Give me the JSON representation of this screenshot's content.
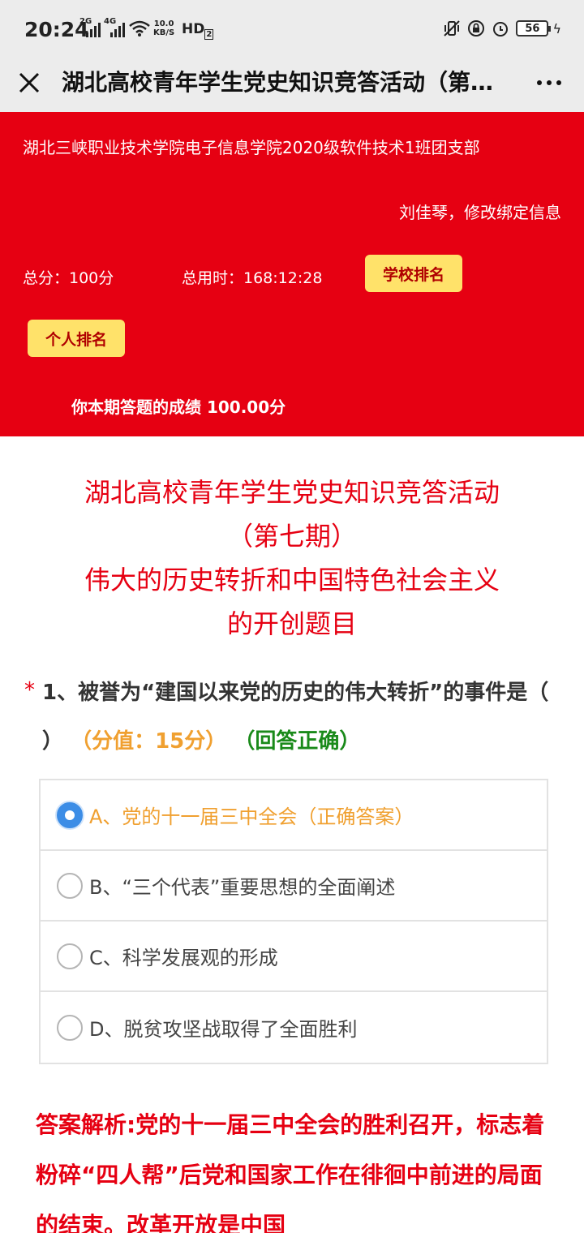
{
  "status_bar": {
    "time": "20:24",
    "signal_1": "2G",
    "signal_2": "4G",
    "network_speed": "10.0",
    "network_unit": "KB/S",
    "hd": "HD",
    "hd_sub": "2",
    "battery": "56",
    "icons": [
      "signal-icon",
      "wifi-icon",
      "vibrate-icon",
      "lock-icon",
      "alarm-icon",
      "battery-icon",
      "charging-icon"
    ]
  },
  "header": {
    "title": "湖北高校青年学生党史知识竞答活动（第…"
  },
  "banner": {
    "org": "湖北三峡职业技术学院电子信息学院2020级软件技术1班团支部",
    "user_line": "刘佳琴，修改绑定信息",
    "total_score": "总分：100分",
    "total_time": "总用时：168:12:28",
    "school_rank_label": "学校排名",
    "personal_rank_label": "个人排名",
    "result": "你本期答题的成绩 100.00分"
  },
  "quiz": {
    "title_line1": "湖北高校青年学生党史知识竞答活动",
    "title_line2": "（第七期）",
    "title_line3": "伟大的历史转折和中国特色社会主义",
    "title_line4": "的开创题目"
  },
  "question": {
    "required_mark": "*",
    "text": "1、被誉为“建国以来党的历史的伟大转折”的事件是（ ）",
    "score": "（分值：15分）",
    "status": "（回答正确）",
    "options": [
      {
        "label": "A、党的十一届三中全会（正确答案）",
        "checked": true
      },
      {
        "label": "B、“三个代表”重要思想的全面阐述",
        "checked": false
      },
      {
        "label": "C、科学发展观的形成",
        "checked": false
      },
      {
        "label": "D、脱贫攻坚战取得了全面胜利",
        "checked": false
      }
    ]
  },
  "analysis": {
    "text": "答案解析:党的十一届三中全会的胜利召开，标志着粉碎“四人帮”后党和国家工作在徘徊中前进的局面的结束。改革开放是中国"
  },
  "colors": {
    "accent_red": "#e60012",
    "rank_button_bg": "#ffe26a",
    "correct_orange": "#f0a030",
    "status_green": "#1a8a1a",
    "radio_blue": "#3c8de6"
  }
}
